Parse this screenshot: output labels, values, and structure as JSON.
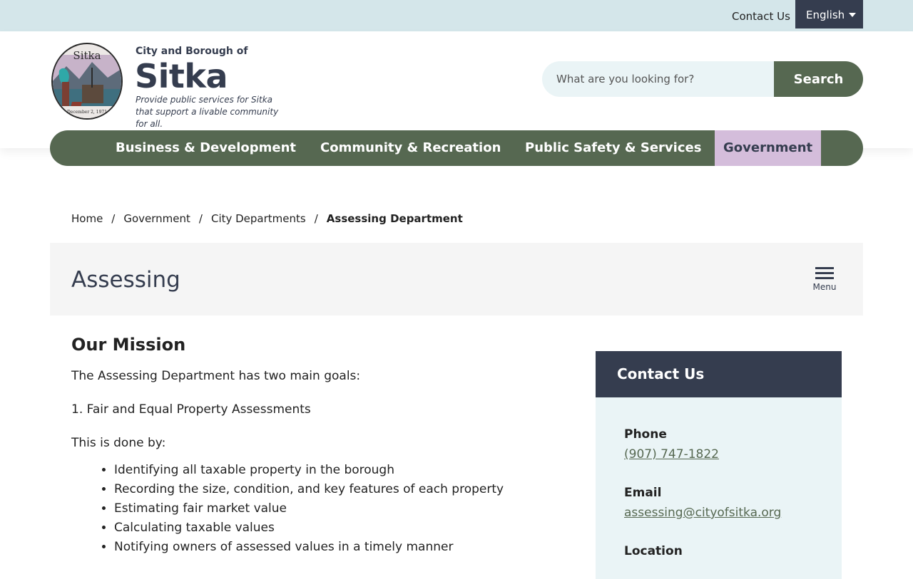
{
  "utility": {
    "contact_label": "Contact Us",
    "language": "English"
  },
  "brand": {
    "pre": "City and Borough of",
    "name": "Sitka",
    "tagline": "Provide public services for Sitka that support a livable community for all.",
    "seal_text_top": "Sitka",
    "seal_text_bottom": "December 2, 1971"
  },
  "search": {
    "placeholder": "What are you looking for?",
    "button_label": "Search"
  },
  "nav": {
    "items": [
      {
        "label": "Business & Development"
      },
      {
        "label": "Community & Recreation"
      },
      {
        "label": "Public Safety & Services"
      },
      {
        "label": "Government"
      }
    ]
  },
  "breadcrumb": {
    "items": [
      "Home",
      "Government",
      "City Departments",
      "Assessing Department"
    ],
    "separator": "/"
  },
  "page": {
    "title": "Assessing",
    "menu_label": "Menu"
  },
  "content": {
    "heading": "Our Mission",
    "intro": "The Assessing Department has two main goals:",
    "goal_1": "1. Fair and Equal Property Assessments",
    "done_by": "This is done by:",
    "bullets": [
      "Identifying all taxable property in the borough",
      "Recording the size, condition, and key features of each property",
      "Estimating fair market value",
      "Calculating taxable values",
      "Notifying owners of assessed values in a timely manner"
    ]
  },
  "sidebar": {
    "title": "Contact Us",
    "phone_label": "Phone",
    "phone": "(907) 747-1822",
    "email_label": "Email",
    "email": "assessing@cityofsitka.org",
    "location_label": "Location"
  },
  "colors": {
    "utility_bg": "#d4e6ea",
    "navy": "#353d4f",
    "green": "#566851",
    "lavender": "#d4bddb",
    "sidebar_bg": "#eaf4f6"
  }
}
